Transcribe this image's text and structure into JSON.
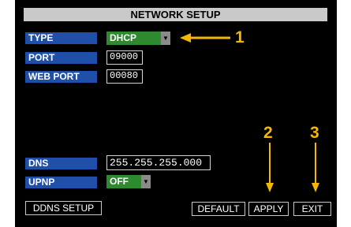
{
  "title": "NETWORK SETUP",
  "fields": {
    "type_label": "TYPE",
    "type_value": "DHCP",
    "port_label": "PORT",
    "port_value": "09000",
    "web_port_label": "WEB PORT",
    "web_port_value": "00080",
    "dns_label": "DNS",
    "dns_value": "255.255.255.000",
    "upnp_label": "UPNP",
    "upnp_value": "OFF"
  },
  "buttons": {
    "ddns": "DDNS SETUP",
    "default": "DEFAULT",
    "apply": "APPLY",
    "exit": "EXIT"
  },
  "annotations": {
    "one": "1",
    "two": "2",
    "three": "3"
  },
  "colors": {
    "label_bg": "#1f4fa8",
    "dropdown_bg": "#2f8a2f",
    "annotation": "#f5b800",
    "title_bg": "#c9c9c9"
  },
  "icons": {
    "dropdown": "chevron-down-icon",
    "annotation_arrow": "arrow-icon"
  }
}
